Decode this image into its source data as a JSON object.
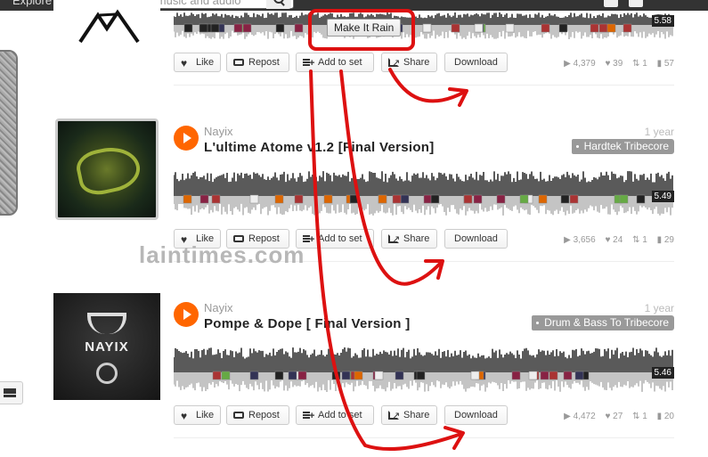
{
  "topbar": {
    "explore_label": "Explore",
    "search_placeholder": "Find artists, music and audio"
  },
  "watermark": "laintimes.com",
  "annotation_button": "Make It Rain",
  "actions": {
    "like": "Like",
    "repost": "Repost",
    "add_to_set": "Add to set",
    "share": "Share",
    "download": "Download"
  },
  "tracks": [
    {
      "duration": "5.58",
      "stats": {
        "plays": "4,379",
        "likes": "39",
        "reposts": "1",
        "comments": "57"
      }
    },
    {
      "user": "Nayix",
      "title": "L'ultime Atome v1.2 [Final Version]",
      "age": "1 year",
      "tag": "Hardtek Tribecore",
      "duration": "5.49",
      "stats": {
        "plays": "3,656",
        "likes": "24",
        "reposts": "1",
        "comments": "29"
      }
    },
    {
      "user": "Nayix",
      "title": "Pompe & Dope [ Final Version ]",
      "age": "1 year",
      "tag": "Drum & Bass To Tribecore",
      "art_logo": "NAYIX",
      "duration": "5.46",
      "stats": {
        "plays": "4,472",
        "likes": "27",
        "reposts": "1",
        "comments": "20"
      }
    }
  ],
  "colors": {
    "accent": "#ff6600",
    "annotation_red": "#dd1111",
    "waveform": "#555555"
  }
}
